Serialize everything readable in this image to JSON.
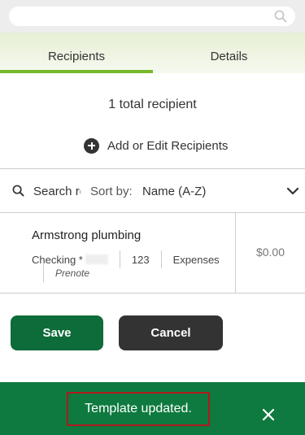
{
  "tabs": [
    {
      "label": "Recipients",
      "active": true
    },
    {
      "label": "Details",
      "active": false
    }
  ],
  "summary": {
    "total_text": "1 total recipient"
  },
  "actions": {
    "add_edit_label": "Add or Edit Recipients"
  },
  "filter": {
    "search_placeholder": "Search re",
    "sort_label": "Sort by:",
    "sort_value": "Name (A-Z)"
  },
  "recipient": {
    "name": "Armstrong plumbing",
    "account_type": "Checking *",
    "routing_suffix": "123",
    "category": "Expenses",
    "status": "Prenote",
    "amount": "$0.00"
  },
  "buttons": {
    "save_label": "Save",
    "cancel_label": "Cancel"
  },
  "toast": {
    "message": "Template updated."
  },
  "colors": {
    "accent_green": "#76b82a",
    "save_green": "#0e6b3a",
    "toast_green": "#0e7a3f",
    "cancel_dark": "#333333",
    "highlight_red": "#b0191e"
  },
  "icons": [
    "search-icon",
    "plus-circle-icon",
    "chevron-down-icon",
    "close-icon"
  ]
}
